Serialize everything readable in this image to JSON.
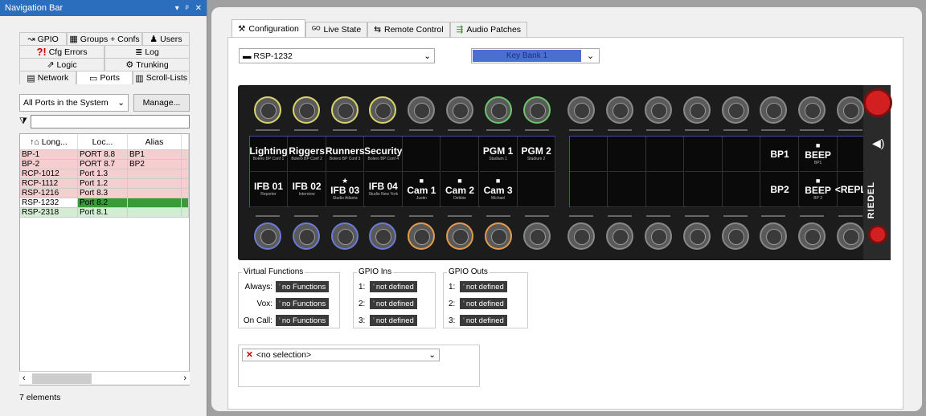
{
  "nav": {
    "title": "Navigation Bar",
    "pin": "▾ ᵖ ✕"
  },
  "tabs": {
    "row1": [
      {
        "icon": "↝",
        "label": "GPIO"
      },
      {
        "icon": "▦",
        "label": "Groups + Confs"
      },
      {
        "icon": "♟",
        "label": "Users"
      }
    ],
    "row2": [
      {
        "icon": "?!",
        "label": "Cfg Errors"
      },
      {
        "icon": "≣",
        "label": "Log"
      }
    ],
    "row3": [
      {
        "icon": "⇗",
        "label": "Logic"
      },
      {
        "icon": "⚙",
        "label": "Trunking"
      }
    ],
    "row4": [
      {
        "icon": "▤",
        "label": "Network"
      },
      {
        "icon": "▭",
        "label": "Ports"
      },
      {
        "icon": "▥",
        "label": "Scroll-Lists"
      }
    ]
  },
  "filter": {
    "select": "All Ports in the System",
    "manage": "Manage..."
  },
  "grid": {
    "headers": [
      "Long...",
      "Loc...",
      "Alias"
    ],
    "rows": [
      {
        "a": "BP-1",
        "b": "PORT 8.8",
        "c": "BP1"
      },
      {
        "a": "BP-2",
        "b": "PORT 8.7",
        "c": "BP2"
      },
      {
        "a": "RCP-1012",
        "b": "Port 1.3",
        "c": ""
      },
      {
        "a": "RCP-1112",
        "b": "Port 1.2",
        "c": ""
      },
      {
        "a": "RSP-1216",
        "b": "Port 8.3",
        "c": ""
      },
      {
        "a": "RSP-1232",
        "b": "Port 8.2",
        "c": ""
      },
      {
        "a": "RSP-2318",
        "b": "Port 8.1",
        "c": ""
      }
    ]
  },
  "status": "7 elements",
  "main_tabs": [
    {
      "icon": "⚒",
      "label": "Configuration"
    },
    {
      "icon": "ᴳᴼ",
      "label": "Live State"
    },
    {
      "icon": "⇆",
      "label": "Remote Control"
    },
    {
      "icon": "⇶",
      "label": "Audio Patches"
    }
  ],
  "port_select": "RSP-1232",
  "key_bank": "Key Bank 1",
  "display_top": [
    {
      "big": "Lighting",
      "sm": "Bolero BP Conf 1"
    },
    {
      "big": "Riggers",
      "sm": "Bolero BP Conf 2"
    },
    {
      "big": "Runners",
      "sm": "Bolero BP Conf 3"
    },
    {
      "big": "Security",
      "sm": "Bolero BP Conf 4"
    },
    {
      "big": "",
      "sm": ""
    },
    {
      "big": "",
      "sm": ""
    },
    {
      "big": "PGM 1",
      "sm": "Stadium 1"
    },
    {
      "big": "PGM 2",
      "sm": "Stadium 2"
    }
  ],
  "display_bottom": [
    {
      "ic": "",
      "big": "IFB 01",
      "sm": "Reporter"
    },
    {
      "ic": "",
      "big": "IFB 02",
      "sm": "Interview"
    },
    {
      "ic": "★",
      "big": "IFB 03",
      "sm": "Studio Atlanta"
    },
    {
      "ic": "",
      "big": "IFB 04",
      "sm": "Studio New York"
    },
    {
      "ic": "■",
      "big": "Cam 1",
      "sm": "Justin"
    },
    {
      "ic": "■",
      "big": "Cam 2",
      "sm": "Debbie"
    },
    {
      "ic": "■",
      "big": "Cam 3",
      "sm": "Michael"
    },
    {
      "ic": "",
      "big": "",
      "sm": ""
    }
  ],
  "display2_top": [
    {
      "ic": "",
      "big": "",
      "sm": ""
    },
    {
      "ic": "",
      "big": "",
      "sm": ""
    },
    {
      "ic": "",
      "big": "",
      "sm": ""
    },
    {
      "ic": "",
      "big": "",
      "sm": ""
    },
    {
      "ic": "",
      "big": "",
      "sm": ""
    },
    {
      "ic": "",
      "big": "BP1",
      "sm": ""
    },
    {
      "ic": "■",
      "big": "BEEP",
      "sm": "BP1"
    },
    {
      "ic": "",
      "big": "",
      "sm": ""
    }
  ],
  "display2_bottom": [
    {
      "ic": "",
      "big": "",
      "sm": ""
    },
    {
      "ic": "",
      "big": "",
      "sm": ""
    },
    {
      "ic": "",
      "big": "",
      "sm": ""
    },
    {
      "ic": "",
      "big": "",
      "sm": ""
    },
    {
      "ic": "",
      "big": "",
      "sm": ""
    },
    {
      "ic": "",
      "big": "BP2",
      "sm": ""
    },
    {
      "ic": "■",
      "big": "BEEP",
      "sm": "BP 2"
    },
    {
      "ic": "",
      "big": "<REPLY>",
      "sm": ""
    }
  ],
  "brand": "RIEDEL",
  "vf": {
    "title": "Virtual Functions",
    "rows": [
      {
        "l": "Always:",
        "v": "no Functions"
      },
      {
        "l": "Vox:",
        "v": "no Functions"
      },
      {
        "l": "On Call:",
        "v": "no Functions"
      }
    ]
  },
  "gin": {
    "title": "GPIO Ins",
    "rows": [
      {
        "l": "1:",
        "v": "not defined"
      },
      {
        "l": "2:",
        "v": "not defined"
      },
      {
        "l": "3:",
        "v": "not defined"
      }
    ]
  },
  "gout": {
    "title": "GPIO Outs",
    "rows": [
      {
        "l": "1:",
        "v": "not defined"
      },
      {
        "l": "2:",
        "v": "not defined"
      },
      {
        "l": "3:",
        "v": "not defined"
      }
    ]
  },
  "nosel": "<no selection>"
}
